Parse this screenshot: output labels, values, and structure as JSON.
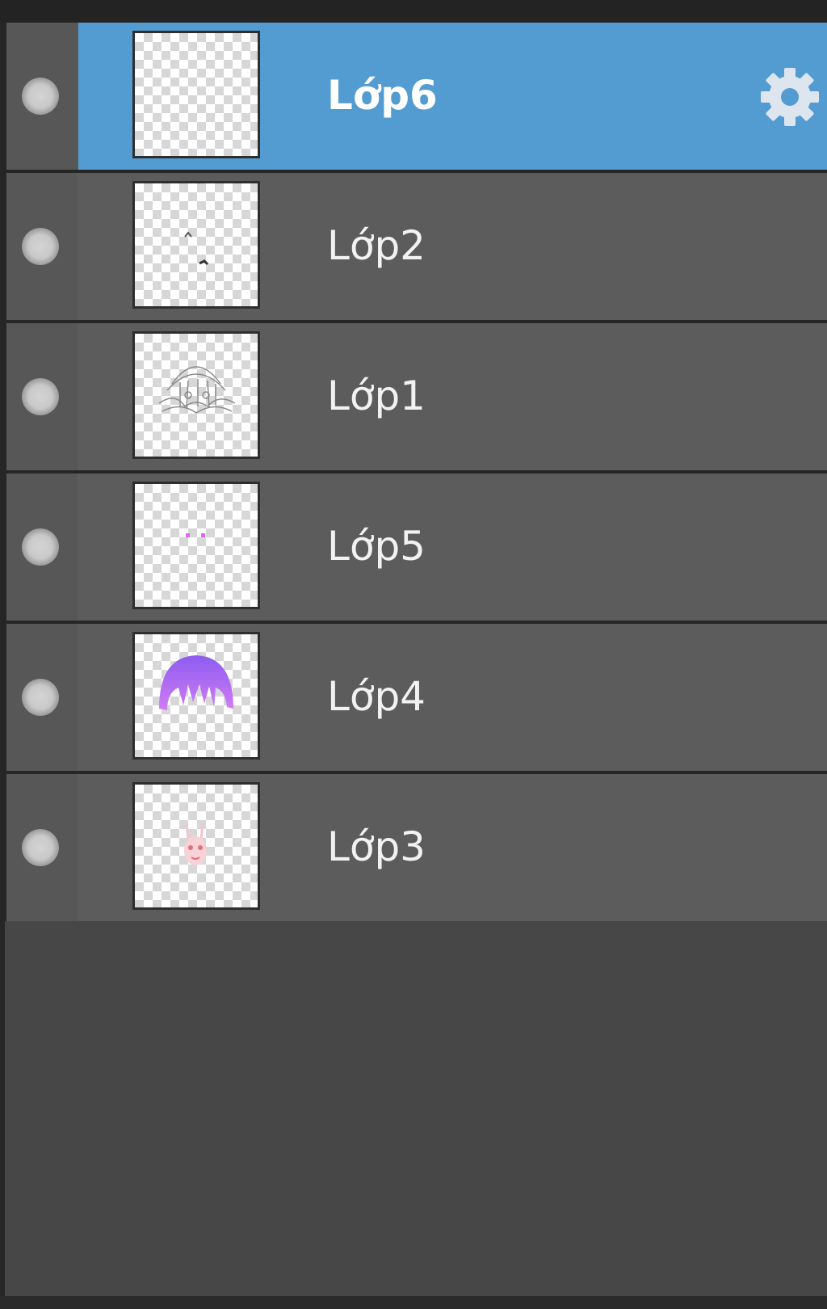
{
  "layers_panel": {
    "layers": [
      {
        "name": "Lớp6",
        "selected": true,
        "thumb_icon": "empty-layer-thumbnail"
      },
      {
        "name": "Lớp2",
        "selected": false,
        "thumb_icon": "eye-marks-thumbnail"
      },
      {
        "name": "Lớp1",
        "selected": false,
        "thumb_icon": "line-art-sketch-thumbnail"
      },
      {
        "name": "Lớp5",
        "selected": false,
        "thumb_icon": "pink-dots-thumbnail"
      },
      {
        "name": "Lớp4",
        "selected": false,
        "thumb_icon": "purple-hair-thumbnail"
      },
      {
        "name": "Lớp3",
        "selected": false,
        "thumb_icon": "pink-face-thumbnail"
      }
    ],
    "settings_icon": "gear-icon",
    "colors": {
      "selected_row": "#539cd1",
      "row": "#5c5c5c",
      "panel_empty": "#474747"
    }
  }
}
